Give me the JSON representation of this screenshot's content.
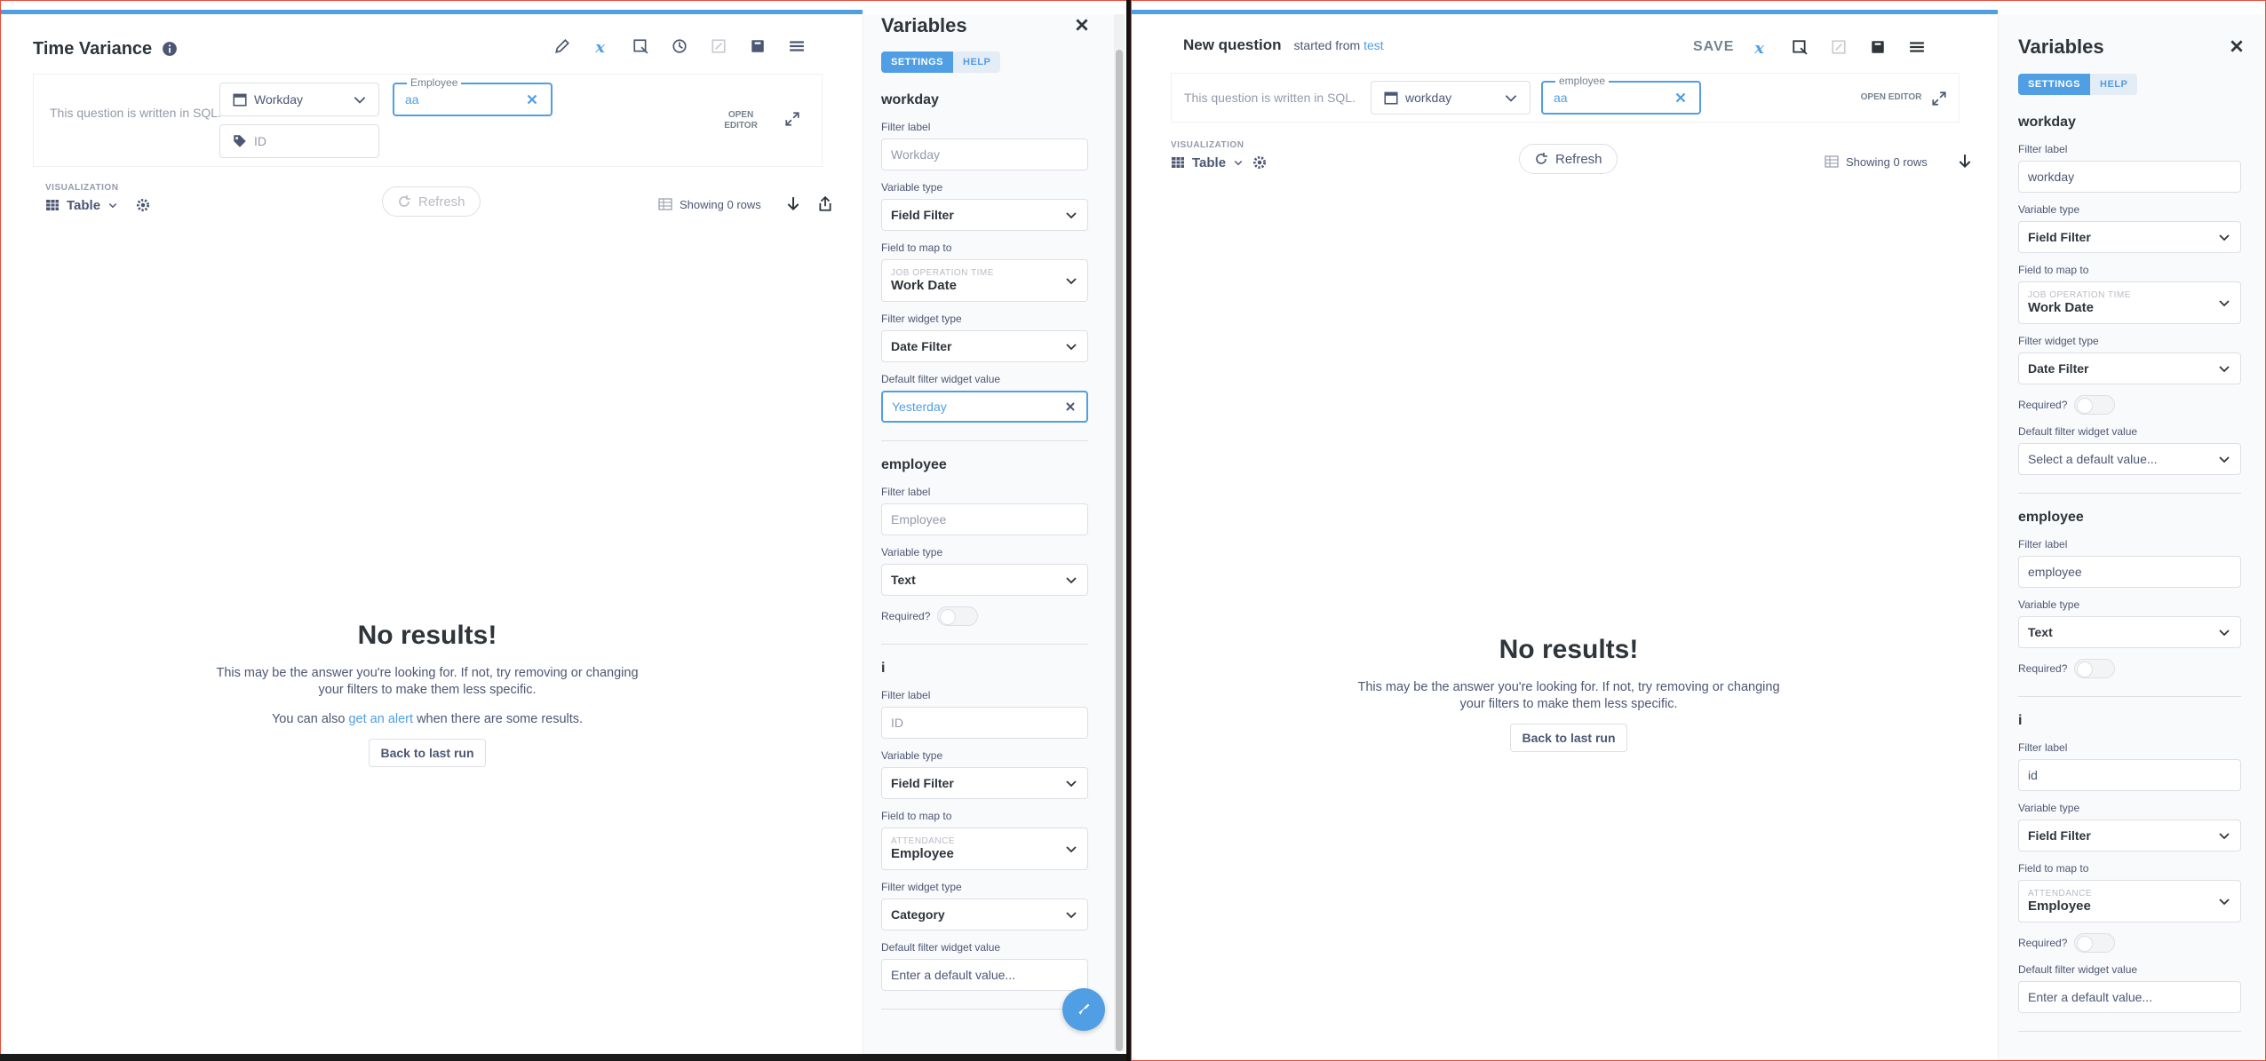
{
  "left": {
    "title": "Time Variance",
    "editor_note": "This question is written in SQL.",
    "widgets": {
      "workday": "Workday",
      "employee_label": "Employee",
      "employee_value": "aa",
      "id": "ID"
    },
    "open_editor": "OPEN EDITOR",
    "viz_label": "VISUALIZATION",
    "viz_value": "Table",
    "refresh": "Refresh",
    "row_count": "Showing 0 rows",
    "empty": {
      "title": "No results!",
      "body": "This may be the answer you're looking for. If not, try removing or changing your filters to make them less specific.",
      "alert_prefix": "You can also",
      "alert_link": "get an alert",
      "alert_suffix": "when there are some results.",
      "back": "Back to last run"
    },
    "sidebar": {
      "title": "Variables",
      "tab_settings": "SETTINGS",
      "tab_help": "HELP",
      "labels": {
        "filter_label": "Filter label",
        "variable_type": "Variable type",
        "field_to_map": "Field to map to",
        "widget_type": "Filter widget type",
        "default_value": "Default filter widget value",
        "required": "Required?"
      },
      "workday": {
        "name": "workday",
        "filter_label": "Workday",
        "variable_type": "Field Filter",
        "map_table": "JOB OPERATION TIME",
        "map_field": "Work Date",
        "widget_type": "Date Filter",
        "default_value": "Yesterday"
      },
      "employee": {
        "name": "employee",
        "filter_label": "Employee",
        "variable_type": "Text"
      },
      "id": {
        "name": "i",
        "filter_label": "ID",
        "variable_type": "Field Filter",
        "map_table": "ATTENDANCE",
        "map_field": "Employee",
        "widget_type": "Category",
        "default_placeholder": "Enter a default value..."
      }
    }
  },
  "right": {
    "title": "New question",
    "started_from": "started from",
    "started_link": "test",
    "save": "SAVE",
    "editor_note": "This question is written in SQL.",
    "widgets": {
      "workday": "workday",
      "employee_label": "employee",
      "employee_value": "aa"
    },
    "open_editor": "OPEN EDITOR",
    "viz_label": "VISUALIZATION",
    "viz_value": "Table",
    "refresh": "Refresh",
    "row_count": "Showing 0 rows",
    "empty": {
      "title": "No results!",
      "body": "This may be the answer you're looking for. If not, try removing or changing your filters to make them less specific.",
      "back": "Back to last run"
    },
    "sidebar": {
      "title": "Variables",
      "tab_settings": "SETTINGS",
      "tab_help": "HELP",
      "labels": {
        "filter_label": "Filter label",
        "variable_type": "Variable type",
        "field_to_map": "Field to map to",
        "widget_type": "Filter widget type",
        "default_value": "Default filter widget value",
        "required": "Required?"
      },
      "workday": {
        "name": "workday",
        "filter_label": "workday",
        "variable_type": "Field Filter",
        "map_table": "JOB OPERATION TIME",
        "map_field": "Work Date",
        "widget_type": "Date Filter",
        "default_placeholder": "Select a default value..."
      },
      "employee": {
        "name": "employee",
        "filter_label": "employee",
        "variable_type": "Text"
      },
      "id": {
        "name": "i",
        "filter_label": "id",
        "variable_type": "Field Filter",
        "map_table": "ATTENDANCE",
        "map_field": "Employee",
        "default_placeholder": "Enter a default value..."
      }
    }
  }
}
